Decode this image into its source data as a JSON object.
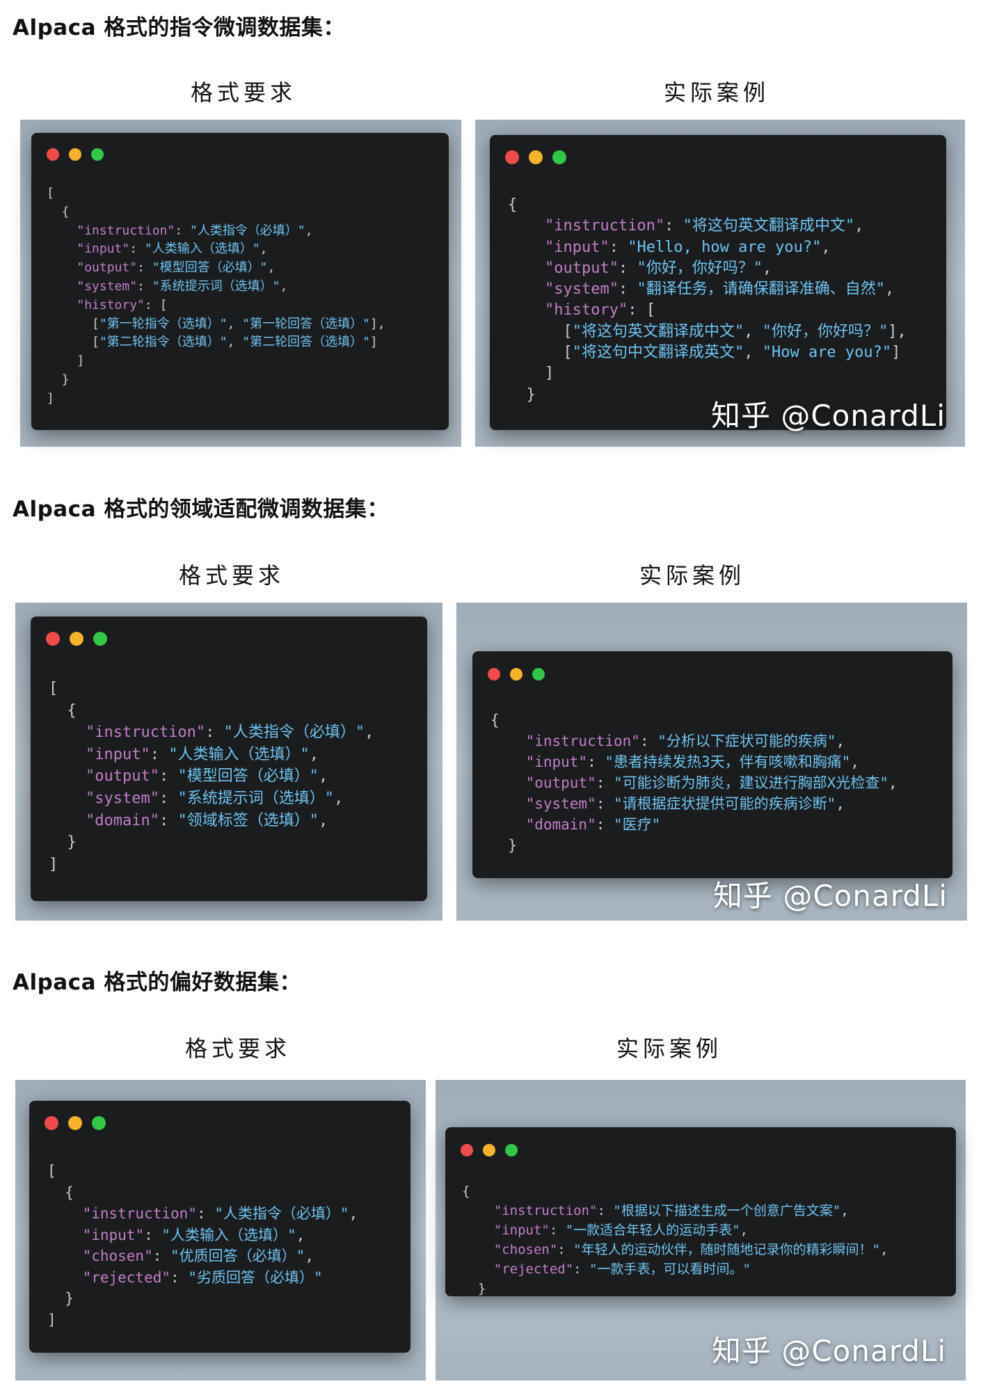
{
  "sections": [
    {
      "title": "Alpaca 格式的指令微调数据集：",
      "left_heading": "格式要求",
      "right_heading": "实际案例",
      "left_code": [
        "[",
        "  {",
        "    \"instruction\": \"人类指令（必填）\",",
        "    \"input\": \"人类输入（选填）\",",
        "    \"output\": \"模型回答（必填）\",",
        "    \"system\": \"系统提示词（选填）\",",
        "    \"history\": [",
        "      [\"第一轮指令（选填）\", \"第一轮回答（选填）\"],",
        "      [\"第二轮指令（选填）\", \"第二轮回答（选填）\"]",
        "    ]",
        "  }",
        "]"
      ],
      "right_code": [
        "{",
        "    \"instruction\": \"将这句英文翻译成中文\",",
        "    \"input\": \"Hello, how are you?\",",
        "    \"output\": \"你好，你好吗？\",",
        "    \"system\": \"翻译任务，请确保翻译准确、自然\",",
        "    \"history\": [",
        "      [\"将这句英文翻译成中文\", \"你好，你好吗？\"],",
        "      [\"将这句中文翻译成英文\", \"How are you?\"]",
        "    ]",
        "  }"
      ],
      "watermark": "知乎 @ConardLi"
    },
    {
      "title": "Alpaca 格式的领域适配微调数据集：",
      "left_heading": "格式要求",
      "right_heading": "实际案例",
      "left_code": [
        "[",
        "  {",
        "    \"instruction\": \"人类指令（必填）\",",
        "    \"input\": \"人类输入（选填）\",",
        "    \"output\": \"模型回答（必填）\",",
        "    \"system\": \"系统提示词（选填）\",",
        "    \"domain\": \"领域标签（选填）\",",
        "  }",
        "]"
      ],
      "right_code": [
        "{",
        "    \"instruction\": \"分析以下症状可能的疾病\",",
        "    \"input\": \"患者持续发热3天，伴有咳嗽和胸痛\",",
        "    \"output\": \"可能诊断为肺炎，建议进行胸部X光检查\",",
        "    \"system\": \"请根据症状提供可能的疾病诊断\",",
        "    \"domain\": \"医疗\"",
        "  }"
      ],
      "watermark": "知乎 @ConardLi"
    },
    {
      "title": "Alpaca 格式的偏好数据集：",
      "left_heading": "格式要求",
      "right_heading": "实际案例",
      "left_code": [
        "[",
        "  {",
        "    \"instruction\": \"人类指令（必填）\",",
        "    \"input\": \"人类输入（选填）\",",
        "    \"chosen\": \"优质回答（必填）\",",
        "    \"rejected\": \"劣质回答（必填）\"",
        "  }",
        "]"
      ],
      "right_code": [
        "{",
        "    \"instruction\": \"根据以下描述生成一个创意广告文案\",",
        "    \"input\": \"一款适合年轻人的运动手表\",",
        "    \"chosen\": \"年轻人的运动伙伴，随时随地记录你的精彩瞬间！\",",
        "    \"rejected\": \"一款手表，可以看时间。\"",
        "  }"
      ],
      "watermark": "知乎 @ConardLi"
    }
  ],
  "colors": {
    "window_bg": "#1b1c1e",
    "key": "#c27ec9",
    "string": "#6fc4f2",
    "punct": "#c9ccd0"
  }
}
